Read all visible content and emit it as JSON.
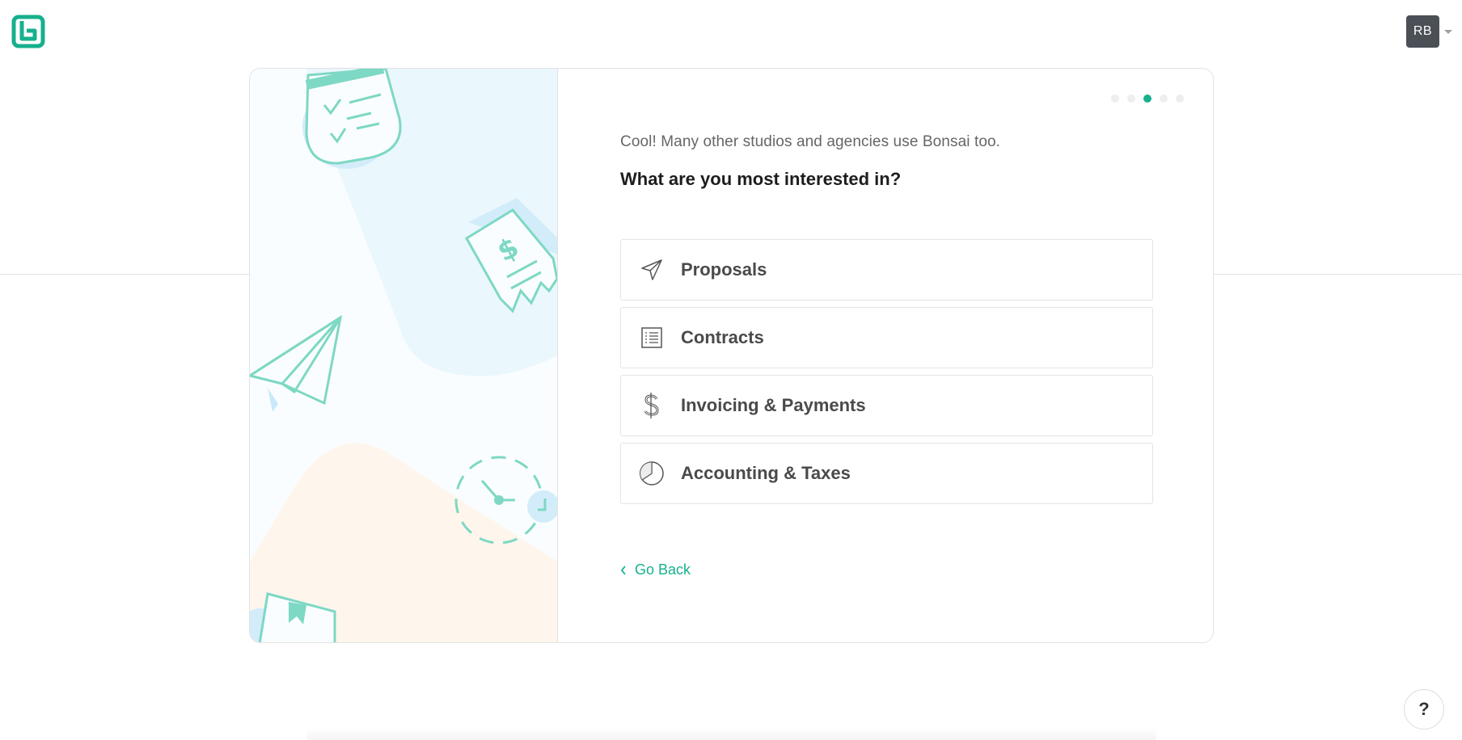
{
  "user": {
    "initials": "RB"
  },
  "steps": {
    "total": 5,
    "active": 3
  },
  "onboarding": {
    "intro": "Cool!  Many other studios and agencies use Bonsai too.",
    "question": "What are you most interested in?",
    "options": [
      {
        "label": "Proposals",
        "icon": "paper-plane-icon"
      },
      {
        "label": "Contracts",
        "icon": "list-document-icon"
      },
      {
        "label": "Invoicing & Payments",
        "icon": "dollar-icon"
      },
      {
        "label": "Accounting & Taxes",
        "icon": "pie-chart-icon"
      }
    ],
    "back_label": "Go Back"
  },
  "help": {
    "label": "?"
  },
  "colors": {
    "accent": "#17b08e",
    "illustration": "#7dd8c4",
    "avatar_bg": "#4a5056"
  }
}
